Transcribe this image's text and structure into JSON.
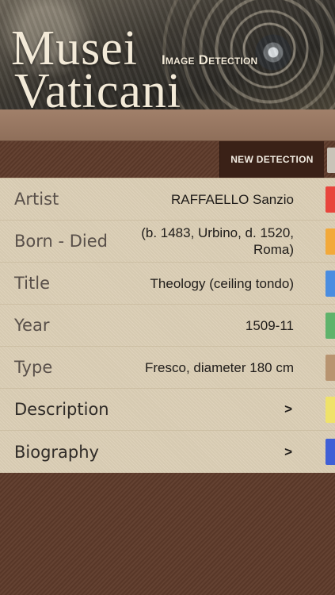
{
  "header": {
    "title_line1": "Musei",
    "title_line2": "Vaticani",
    "subtitle": "Image Detection"
  },
  "toolbar": {
    "new_detection_label": "NEW DETECTION",
    "tab_color": "#c9c3b8"
  },
  "details": {
    "rows": [
      {
        "label": "Artist",
        "value": "RAFFAELLO Sanzio",
        "tab_color": "#e8453c"
      },
      {
        "label": "Born - Died",
        "value": "(b. 1483, Urbino, d. 1520, Roma)",
        "tab_color": "#f2a93a"
      },
      {
        "label": "Title",
        "value": "Theology (ceiling tondo)",
        "tab_color": "#4a8de0"
      },
      {
        "label": "Year",
        "value": "1509-11",
        "tab_color": "#5fb36b"
      },
      {
        "label": "Type",
        "value": "Fresco, diameter 180 cm",
        "tab_color": "#b89470"
      },
      {
        "label": "Description",
        "value": ">",
        "tab_color": "#efe26a"
      },
      {
        "label": "Biography",
        "value": ">",
        "tab_color": "#3f5fd6"
      }
    ]
  }
}
